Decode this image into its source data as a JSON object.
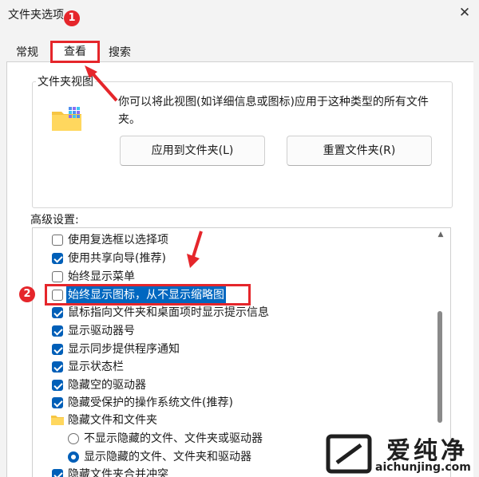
{
  "window": {
    "title": "文件夹选项",
    "close_glyph": "✕"
  },
  "tabs": [
    {
      "label": "常规"
    },
    {
      "label": "查看"
    },
    {
      "label": "搜索"
    }
  ],
  "folder_view": {
    "label": "文件夹视图",
    "description": "你可以将此视图(如详细信息或图标)应用于这种类型的所有文件夹。",
    "apply_button": "应用到文件夹(L)",
    "reset_button": "重置文件夹(R)"
  },
  "advanced": {
    "label": "高级设置:",
    "items": [
      {
        "type": "checkbox",
        "checked": false,
        "label": "使用复选框以选择项"
      },
      {
        "type": "checkbox",
        "checked": true,
        "label": "使用共享向导(推荐)"
      },
      {
        "type": "checkbox",
        "checked": false,
        "label": "始终显示菜单"
      },
      {
        "type": "checkbox",
        "checked": false,
        "label": "始终显示图标，从不显示缩略图",
        "selected": true
      },
      {
        "type": "checkbox",
        "checked": true,
        "label": "鼠标指向文件夹和桌面项时显示提示信息"
      },
      {
        "type": "checkbox",
        "checked": true,
        "label": "显示驱动器号"
      },
      {
        "type": "checkbox",
        "checked": true,
        "label": "显示同步提供程序通知"
      },
      {
        "type": "checkbox",
        "checked": true,
        "label": "显示状态栏"
      },
      {
        "type": "checkbox",
        "checked": true,
        "label": "隐藏空的驱动器"
      },
      {
        "type": "checkbox",
        "checked": true,
        "label": "隐藏受保护的操作系统文件(推荐)"
      },
      {
        "type": "folder",
        "label": "隐藏文件和文件夹"
      },
      {
        "type": "radio",
        "checked": false,
        "label": "不显示隐藏的文件、文件夹或驱动器"
      },
      {
        "type": "radio",
        "checked": true,
        "label": "显示隐藏的文件、文件夹和驱动器"
      },
      {
        "type": "checkbox",
        "checked": true,
        "label": "隐藏文件夹合并冲突"
      }
    ]
  },
  "annotations": {
    "step1": "1",
    "step2": "2",
    "color": "#e5262b"
  },
  "watermark": {
    "brand": "爱纯净",
    "url": "aichunjing.com"
  }
}
